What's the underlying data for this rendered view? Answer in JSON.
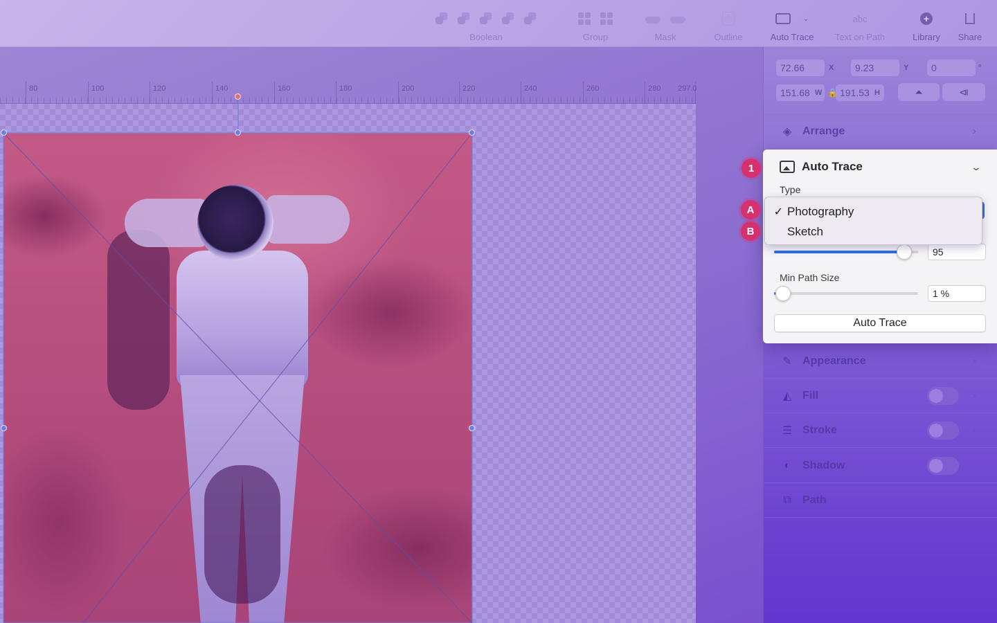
{
  "toolbar": {
    "groups": [
      {
        "label": "Boolean",
        "active": false
      },
      {
        "label": "Group",
        "active": false
      },
      {
        "label": "Mask",
        "active": false
      },
      {
        "label": "Outline",
        "active": false
      },
      {
        "label": "Auto Trace",
        "active": true
      },
      {
        "label": "Text on Path",
        "active": false
      },
      {
        "label": "Library",
        "active": true
      },
      {
        "label": "Share",
        "active": true
      }
    ],
    "text_on_path_glyph": "abc"
  },
  "ruler": {
    "ticks": [
      "80",
      "100",
      "120",
      "140",
      "160",
      "180",
      "200",
      "220",
      "240",
      "260",
      "280",
      "297.0"
    ]
  },
  "inspector": {
    "x_value": "72.66",
    "x_unit": "X",
    "y_value": "9.23",
    "y_unit": "Y",
    "rotation_value": "0",
    "rotation_unit": "°",
    "w_value": "151.68",
    "w_unit": "W",
    "h_value": "191.53",
    "h_unit": "H",
    "sections": [
      {
        "label": "Arrange",
        "icon": "arrange-icon",
        "toggle": false
      },
      {
        "label": "Appearance",
        "icon": "appearance-icon",
        "toggle": false
      },
      {
        "label": "Fill",
        "icon": "fill-icon",
        "toggle": true
      },
      {
        "label": "Stroke",
        "icon": "stroke-icon",
        "toggle": true
      },
      {
        "label": "Shadow",
        "icon": "shadow-icon",
        "toggle": true
      },
      {
        "label": "Path",
        "icon": "path-icon",
        "toggle": false
      }
    ]
  },
  "auto_trace": {
    "title": "Auto Trace",
    "type_label": "Type",
    "type_options": [
      "Photography",
      "Sketch"
    ],
    "selected_type": "Photography",
    "check_mark": "✓",
    "detail_value": "95",
    "detail_fraction": 0.95,
    "min_path_label": "Min Path Size",
    "min_path_value": "1 %",
    "min_path_fraction": 0.01,
    "action_label": "Auto Trace"
  },
  "markers": {
    "one": "1",
    "a": "A",
    "b": "B"
  },
  "colors": {
    "accent": "#2f6fe0",
    "marker": "#d6306f"
  }
}
